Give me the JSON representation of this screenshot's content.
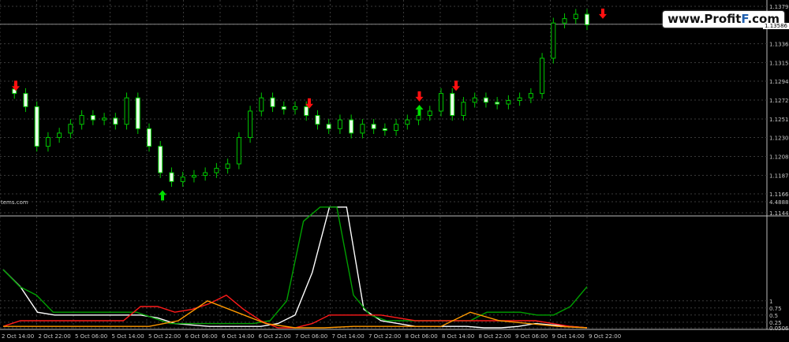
{
  "watermark": {
    "prefix": "www.Profit",
    "highlight": "F",
    "suffix": ".com"
  },
  "indicator_label": "tems.com",
  "current_price_label": "1.13586",
  "colors": {
    "background": "#000000",
    "grid": "#3a3a3a",
    "candle": "#00c800",
    "candle_bull_body": "#000000",
    "candle_bear_body": "#e8ffe8",
    "arrow_up": "#00e000",
    "arrow_down": "#ff1010",
    "line_white": "#ffffff",
    "line_green": "#00a000",
    "line_red": "#ff1a1a",
    "line_orange": "#ff9900"
  },
  "chart_data": [
    {
      "type": "candlestick",
      "y_ticks": [
        "1.13790",
        "1.13586",
        "1.13365",
        "1.13150",
        "1.12940",
        "1.12725",
        "1.12510",
        "1.12300",
        "1.12085",
        "1.11870",
        "1.11660",
        "1.11445"
      ],
      "ylim": [
        1.11445,
        1.1379
      ],
      "x_ticks": [
        "2 Oct 14:00",
        "2 Oct 22:00",
        "5 Oct 06:00",
        "5 Oct 14:00",
        "5 Oct 22:00",
        "6 Oct 06:00",
        "6 Oct 14:00",
        "6 Oct 22:00",
        "7 Oct 06:00",
        "7 Oct 14:00",
        "7 Oct 22:00",
        "8 Oct 06:00",
        "8 Oct 14:00",
        "8 Oct 22:00",
        "9 Oct 06:00",
        "9 Oct 14:00",
        "9 Oct 22:00"
      ],
      "close_path": [
        1.1285,
        1.128,
        1.1265,
        1.122,
        1.123,
        1.1235,
        1.1245,
        1.1255,
        1.125,
        1.1252,
        1.1245,
        1.1275,
        1.124,
        1.122,
        1.119,
        1.118,
        1.1185,
        1.1187,
        1.119,
        1.1195,
        1.12,
        1.123,
        1.126,
        1.1275,
        1.1265,
        1.1262,
        1.1265,
        1.1255,
        1.1245,
        1.124,
        1.125,
        1.1235,
        1.1245,
        1.124,
        1.1238,
        1.1245,
        1.125,
        1.1255,
        1.126,
        1.128,
        1.1255,
        1.127,
        1.1275,
        1.127,
        1.1268,
        1.1272,
        1.1275,
        1.128,
        1.132,
        1.136,
        1.1365,
        1.137,
        1.1358
      ],
      "arrows_up": [
        {
          "x": "5 Oct 22:00",
          "price": 1.1163
        },
        {
          "x": "8 Oct 06:00",
          "price": 1.126
        }
      ],
      "arrows_down": [
        {
          "x": "2 Oct 14:00",
          "price": 1.129
        },
        {
          "x": "7 Oct 06:00",
          "price": 1.127
        },
        {
          "x": "8 Oct 06:00",
          "price": 1.1278
        },
        {
          "x": "8 Oct 14:00",
          "price": 1.129
        },
        {
          "x": "9 Oct 22:00",
          "price": 1.1372
        }
      ]
    },
    {
      "type": "line",
      "y_ticks": [
        "4.48889",
        "1",
        "0.75",
        "0.5",
        "0.25",
        "0.05066"
      ],
      "ylim": [
        0.05066,
        4.48889
      ],
      "series": [
        {
          "color": "line_white",
          "values": [
            2.1,
            1.5,
            0.6,
            0.5,
            0.5,
            0.5,
            0.5,
            0.5,
            0.5,
            0.4,
            0.2,
            0.15,
            0.1,
            0.1,
            0.1,
            0.1,
            0.2,
            0.5,
            2.0,
            4.3,
            4.3,
            0.7,
            0.3,
            0.2,
            0.1,
            0.1,
            0.1,
            0.1,
            0.05,
            0.05,
            0.1,
            0.2,
            0.15,
            0.1,
            0.05
          ]
        },
        {
          "color": "line_green",
          "values": [
            2.1,
            1.5,
            1.2,
            0.6,
            0.6,
            0.6,
            0.6,
            0.6,
            0.6,
            0.4,
            0.2,
            0.2,
            0.2,
            0.2,
            0.2,
            0.2,
            0.3,
            1.0,
            3.8,
            4.3,
            4.3,
            1.2,
            0.5,
            0.3,
            0.3,
            0.3,
            0.3,
            0.3,
            0.3,
            0.6,
            0.6,
            0.6,
            0.5,
            0.5,
            0.8,
            1.5
          ]
        },
        {
          "color": "line_red",
          "values": [
            0.1,
            0.3,
            0.3,
            0.3,
            0.3,
            0.3,
            0.3,
            0.3,
            0.8,
            0.8,
            0.6,
            0.7,
            0.9,
            1.2,
            0.7,
            0.3,
            0.05,
            0.05,
            0.2,
            0.5,
            0.5,
            0.5,
            0.5,
            0.4,
            0.3,
            0.3,
            0.3,
            0.3,
            0.3,
            0.3,
            0.3,
            0.3,
            0.2,
            0.1,
            0.05
          ]
        },
        {
          "color": "line_orange",
          "values": [
            0.1,
            0.1,
            0.1,
            0.1,
            0.1,
            0.1,
            0.3,
            1.0,
            0.6,
            0.2,
            0.05,
            0.05,
            0.1,
            0.1,
            0.1,
            0.1,
            0.6,
            0.3,
            0.2,
            0.1,
            0.05
          ]
        }
      ]
    }
  ]
}
